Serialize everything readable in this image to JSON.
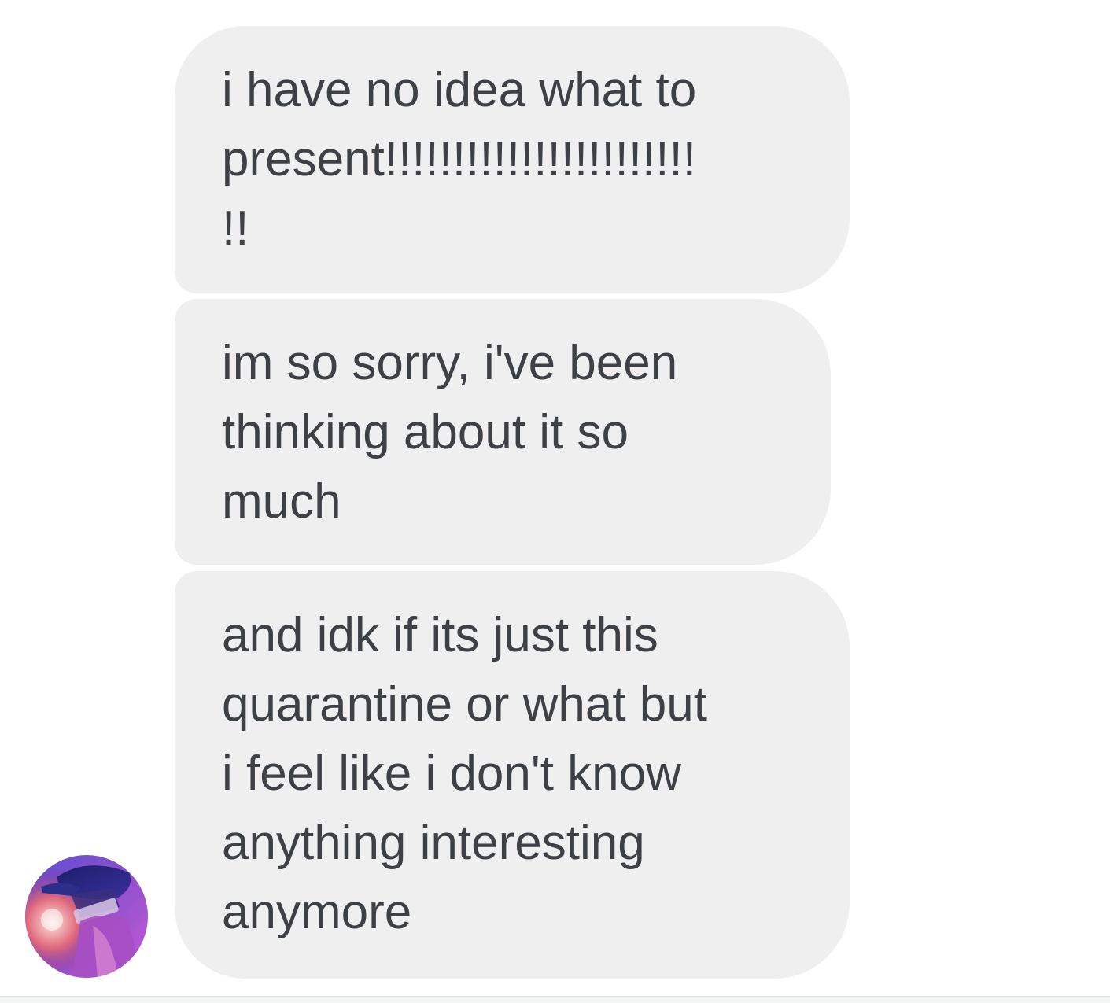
{
  "conversation": {
    "messages": [
      {
        "text": "i have no idea what to\npresent!!!!!!!!!!!!!!!!!!!!!!!\n!!"
      },
      {
        "text": "im so sorry, i've been\nthinking about it so\nmuch"
      },
      {
        "text": "and idk if its just this\nquarantine or what but\ni feel like i don't know\nanything interesting\nanymore"
      }
    ]
  },
  "sender": {
    "avatar_icon": "profile-photo-avatar"
  },
  "colors": {
    "bubble_background": "#efefef",
    "text": "#3d4146",
    "page_background": "#ffffff"
  }
}
